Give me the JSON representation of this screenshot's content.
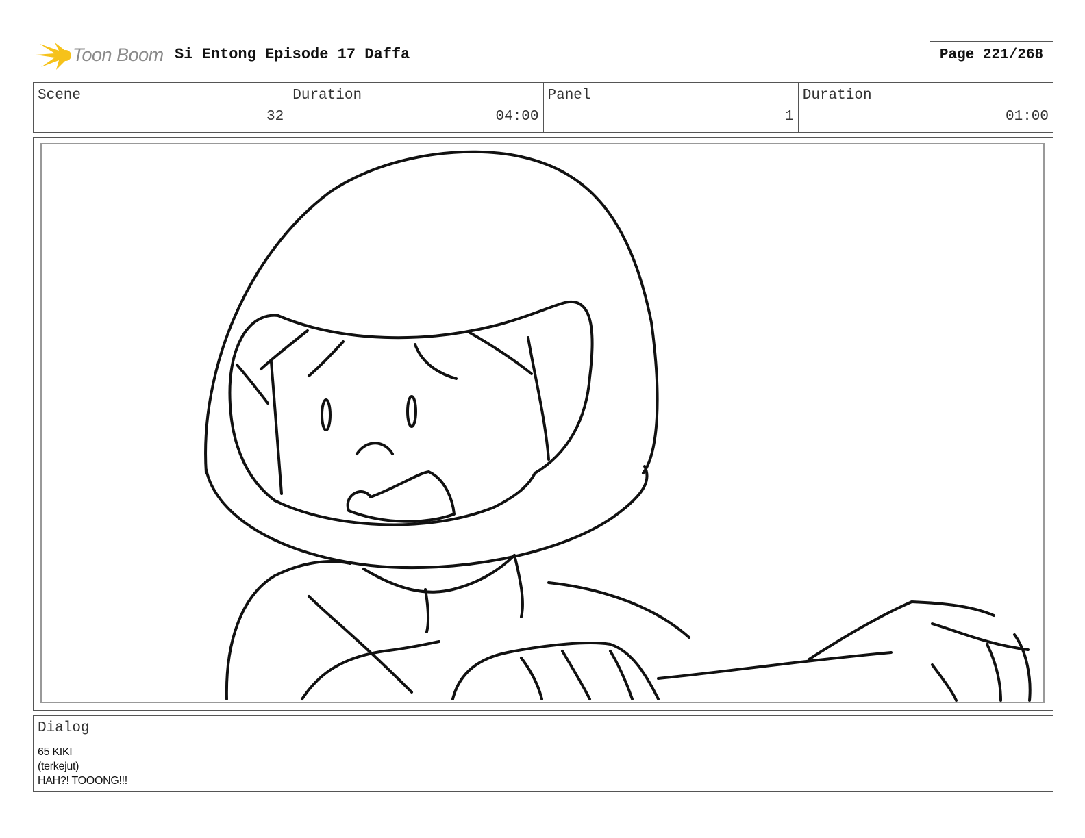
{
  "header": {
    "logo_text": "Toon Boom",
    "title": "Si Entong Episode 17 Daffa",
    "page": "Page 221/268"
  },
  "info": {
    "scene_label": "Scene",
    "scene_value": "32",
    "scene_duration_label": "Duration",
    "scene_duration_value": "04:00",
    "panel_label": "Panel",
    "panel_value": "1",
    "panel_duration_label": "Duration",
    "panel_duration_value": "01:00"
  },
  "dialog": {
    "label": "Dialog",
    "lines": [
      "65 KIKI",
      "(terkejut)",
      "HAH?! TOOONG!!!"
    ]
  },
  "colors": {
    "logo_star": "#f6c21a",
    "logo_text": "#8a8a8a",
    "border": "#555555",
    "panel_border": "#999999"
  }
}
